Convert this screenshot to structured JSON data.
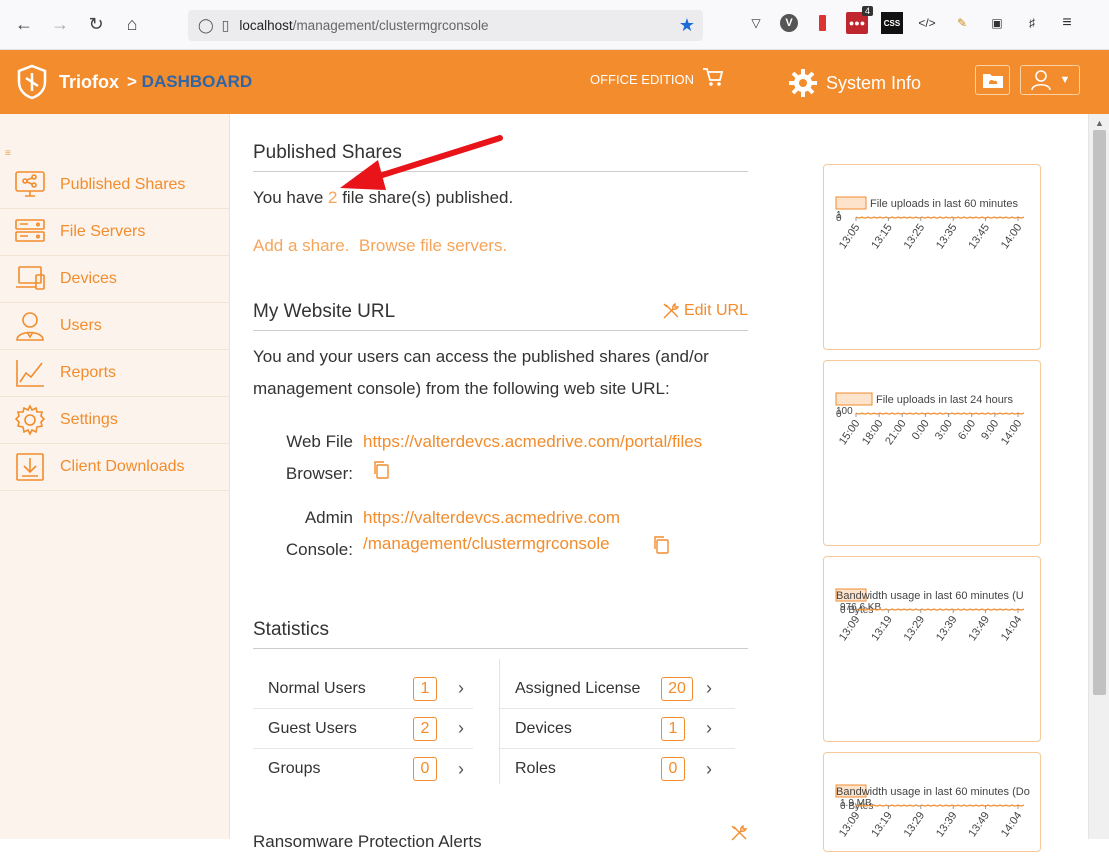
{
  "browser": {
    "url_host": "localhost",
    "url_path": "/management/clustermgrconsole",
    "ext_badge": "4",
    "ext_css": "CSS",
    "ext_v": "V"
  },
  "header": {
    "brand": "Triofox",
    "breadcrumb_sep": ">",
    "breadcrumb_current": "DASHBOARD",
    "edition": "OFFICE EDITION",
    "system_info": "System Info"
  },
  "sidebar": {
    "items": [
      {
        "label": "Published Shares",
        "icon": "share-monitor-icon"
      },
      {
        "label": "File Servers",
        "icon": "server-icon"
      },
      {
        "label": "Devices",
        "icon": "devices-icon"
      },
      {
        "label": "Users",
        "icon": "user-icon"
      },
      {
        "label": "Reports",
        "icon": "chart-icon"
      },
      {
        "label": "Settings",
        "icon": "gear-icon"
      },
      {
        "label": "Client Downloads",
        "icon": "download-icon"
      }
    ]
  },
  "published": {
    "title": "Published Shares",
    "text_pre": "You have ",
    "count": "2",
    "text_post": " file share(s) published.",
    "add_share": "Add a share.",
    "browse": "Browse file servers."
  },
  "website": {
    "title": "My Website URL",
    "edit": "Edit URL",
    "desc_line1": "You and your users can access the published shares (and/or",
    "desc_line2": "management console) from the following web site URL:",
    "web_label1": "Web File",
    "web_label2": "Browser:",
    "web_url": "https://valterdevcs.acmedrive.com/portal/files",
    "admin_label1": "Admin",
    "admin_label2": "Console:",
    "admin_url1": "https://valterdevcs.acmedrive.com",
    "admin_url2": "/management/clustermgrconsole"
  },
  "statistics": {
    "title": "Statistics",
    "left": [
      {
        "label": "Normal Users",
        "value": "1"
      },
      {
        "label": "Guest Users",
        "value": "2"
      },
      {
        "label": "Groups",
        "value": "0"
      }
    ],
    "right": [
      {
        "label": "Assigned License",
        "value": "20"
      },
      {
        "label": "Devices",
        "value": "1"
      },
      {
        "label": "Roles",
        "value": "0"
      }
    ],
    "next_title": "Ransomware Protection Alerts"
  },
  "colors": {
    "accent": "#f28c2c",
    "link": "#f6a55a",
    "breadcrumb": "#2f66a8",
    "sidebar_bg": "#fcf4ec",
    "arrow": "#e8141a"
  },
  "chart_data": [
    {
      "type": "line",
      "title": "File uploads in last 60 minutes",
      "y_labels": [
        "0",
        "1"
      ],
      "categories": [
        "13:05",
        "13:15",
        "13:25",
        "13:35",
        "13:45",
        "14:00"
      ]
    },
    {
      "type": "line",
      "title": "File uploads in last 24 hours",
      "y_labels": [
        "0",
        "100"
      ],
      "categories": [
        "15:00",
        "18:00",
        "21:00",
        "0:00",
        "3:00",
        "6:00",
        "9:00",
        "14:00"
      ]
    },
    {
      "type": "line",
      "title": "Bandwidth usage in last 60 minutes (U",
      "y_labels": [
        "0 Bytes",
        "976.6 KB"
      ],
      "categories": [
        "13:09",
        "13:19",
        "13:29",
        "13:39",
        "13:49",
        "14:04"
      ]
    },
    {
      "type": "line",
      "title": "Bandwidth usage in last 60 minutes (Do",
      "y_labels": [
        "0 Bytes",
        "1.9 MB"
      ],
      "categories": [
        "13:09",
        "13:19",
        "13:29",
        "13:39",
        "13:49",
        "14:04"
      ]
    }
  ]
}
